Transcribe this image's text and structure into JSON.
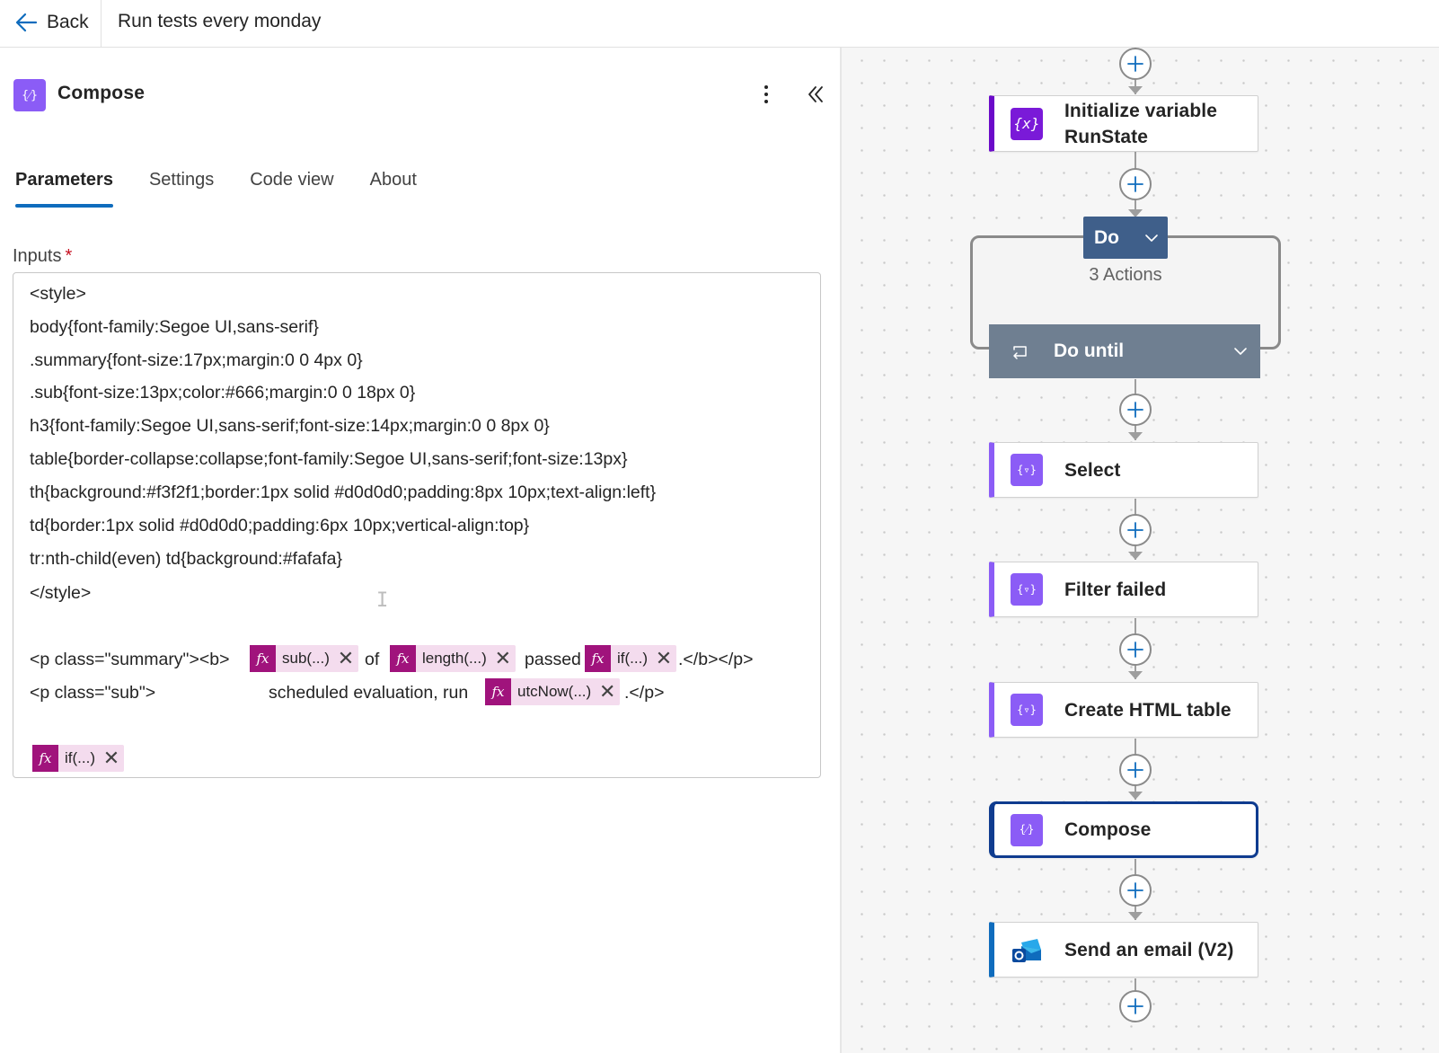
{
  "topbar": {
    "back_label": "Back",
    "flow_title": "Run tests every monday"
  },
  "panel": {
    "action_icon_glyph": "{⁄}",
    "title": "Compose",
    "tabs": [
      {
        "label": "Parameters",
        "active": true
      },
      {
        "label": "Settings",
        "active": false
      },
      {
        "label": "Code view",
        "active": false
      },
      {
        "label": "About",
        "active": false
      }
    ],
    "inputs_label": "Inputs",
    "required_marker": "*",
    "code_lines": [
      "<style>",
      "body{font-family:Segoe UI,sans-serif}",
      ".summary{font-size:17px;margin:0 0 4px 0}",
      ".sub{font-size:13px;color:#666;margin:0 0 18px 0}",
      "h3{font-family:Segoe UI,sans-serif;font-size:14px;margin:0 0 8px 0}",
      "table{border-collapse:collapse;font-family:Segoe UI,sans-serif;font-size:13px}",
      "th{background:#f3f2f1;border:1px solid #d0d0d0;padding:8px 10px;text-align:left}",
      "td{border:1px solid #d0d0d0;padding:6px 10px;vertical-align:top}",
      "tr:nth-child(even) td{background:#fafafa}",
      "</style>"
    ],
    "summary_line": {
      "prefix": "<p class=\"summary\"><b>",
      "of": "of",
      "passed": "passed",
      "suffix": ".</b></p>"
    },
    "sub_line": {
      "prefix": "<p class=\"sub\">",
      "middle": "scheduled evaluation, run",
      "suffix": ".</p>"
    },
    "tokens": {
      "fx_glyph": "fx",
      "close_glyph": "✕",
      "sub": "sub(...)",
      "length": "length(...)",
      "if1": "if(...)",
      "utcnow": "utcNow(...)",
      "if2": "if(...)"
    }
  },
  "canvas": {
    "nodes": {
      "init_variable": {
        "label_line1": "Initialize variable",
        "label_line2": "RunState",
        "icon": "{x}"
      },
      "do": {
        "label": "Do",
        "actions_count": "3 Actions"
      },
      "do_until": {
        "label": "Do until"
      },
      "select": {
        "label": "Select",
        "icon": "{▿}"
      },
      "filter": {
        "label": "Filter failed",
        "icon": "{▿}"
      },
      "html_table": {
        "label": "Create HTML table",
        "icon": "{▿}"
      },
      "compose": {
        "label": "Compose",
        "icon": "{⁄}"
      },
      "email": {
        "label": "Send an email (V2)"
      }
    }
  },
  "colors": {
    "accent": "#0f6cbd",
    "data_ops": "#8b5cf6",
    "variable": "#7a1ad8",
    "token_fx": "#a0137c",
    "token_bg": "#f4dcee",
    "scope_header": "#3f5f8a",
    "do_until_bar": "#6f7f91",
    "selected_border": "#0f3c8f"
  }
}
